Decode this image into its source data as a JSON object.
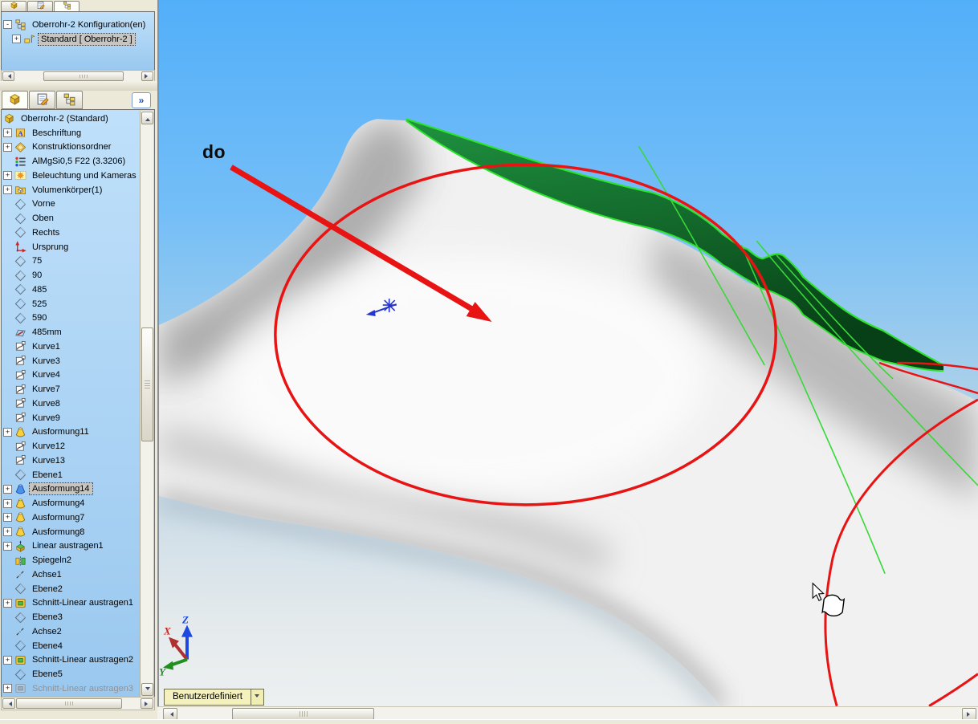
{
  "config_panel": {
    "tabs": [
      {
        "icon": "features"
      },
      {
        "icon": "properties"
      },
      {
        "icon": "configurations"
      }
    ],
    "items": [
      {
        "label": "Oberrohr-2 Konfiguration(en)",
        "icon": "configurations",
        "expand": "-",
        "level": 0
      },
      {
        "label": "Standard [ Oberrohr-2 ]",
        "icon": "config",
        "expand": "+",
        "level": 1,
        "selected": true
      }
    ]
  },
  "feature_panel": {
    "tabs": [
      {
        "icon": "features"
      },
      {
        "icon": "properties"
      },
      {
        "icon": "configurations"
      }
    ],
    "overflow_label": "»",
    "items": [
      {
        "label": "Oberrohr-2 (Standard)",
        "icon": "part",
        "root": true
      },
      {
        "label": "Beschriftung",
        "icon": "annotations",
        "expand": "+"
      },
      {
        "label": "Konstruktionsordner",
        "icon": "design-folder",
        "expand": "+"
      },
      {
        "label": "AlMgSi0,5 F22 (3.3206)",
        "icon": "material"
      },
      {
        "label": "Beleuchtung und Kameras",
        "icon": "lights",
        "expand": "+"
      },
      {
        "label": "Volumenkörper(1)",
        "icon": "solids-folder",
        "expand": "+"
      },
      {
        "label": "Vorne",
        "icon": "plane"
      },
      {
        "label": "Oben",
        "icon": "plane"
      },
      {
        "label": "Rechts",
        "icon": "plane"
      },
      {
        "label": "Ursprung",
        "icon": "origin"
      },
      {
        "label": "75",
        "icon": "plane"
      },
      {
        "label": "90",
        "icon": "plane"
      },
      {
        "label": "485",
        "icon": "plane"
      },
      {
        "label": "525",
        "icon": "plane"
      },
      {
        "label": "590",
        "icon": "plane"
      },
      {
        "label": "485mm",
        "icon": "sketch"
      },
      {
        "label": "Kurve1",
        "icon": "curve"
      },
      {
        "label": "Kurve3",
        "icon": "curve"
      },
      {
        "label": "Kurve4",
        "icon": "curve"
      },
      {
        "label": "Kurve7",
        "icon": "curve"
      },
      {
        "label": "Kurve8",
        "icon": "curve"
      },
      {
        "label": "Kurve9",
        "icon": "curve"
      },
      {
        "label": "Ausformung11",
        "icon": "loft",
        "expand": "+"
      },
      {
        "label": "Kurve12",
        "icon": "curve"
      },
      {
        "label": "Kurve13",
        "icon": "curve"
      },
      {
        "label": "Ebene1",
        "icon": "plane"
      },
      {
        "label": "Ausformung14",
        "icon": "loft-blue",
        "expand": "+",
        "selected": true
      },
      {
        "label": "Ausformung4",
        "icon": "loft",
        "expand": "+"
      },
      {
        "label": "Ausformung7",
        "icon": "loft",
        "expand": "+"
      },
      {
        "label": "Ausformung8",
        "icon": "loft",
        "expand": "+"
      },
      {
        "label": "Linear austragen1",
        "icon": "extrude",
        "expand": "+"
      },
      {
        "label": "Spiegeln2",
        "icon": "mirror"
      },
      {
        "label": "Achse1",
        "icon": "axis"
      },
      {
        "label": "Ebene2",
        "icon": "plane"
      },
      {
        "label": "Schnitt-Linear austragen1",
        "icon": "cut-extrude",
        "expand": "+"
      },
      {
        "label": "Ebene3",
        "icon": "plane"
      },
      {
        "label": "Achse2",
        "icon": "axis"
      },
      {
        "label": "Ebene4",
        "icon": "plane"
      },
      {
        "label": "Schnitt-Linear austragen2",
        "icon": "cut-extrude",
        "expand": "+"
      },
      {
        "label": "Ebene5",
        "icon": "plane"
      },
      {
        "label": "Schnitt-Linear austragen3",
        "icon": "cut-extrude",
        "expand": "+",
        "grayed": true
      }
    ]
  },
  "viewport": {
    "annotation_label": "do",
    "view_selector_value": "Benutzerdefiniert",
    "triad": {
      "x": "X",
      "y": "Y",
      "z": "Z"
    },
    "colors": {
      "annotation_red": "#e81414",
      "edge_lime": "#2ce22c",
      "sketch_blue": "#2636cc",
      "face_green_light": "#1f9240",
      "face_green_dark": "#0a4a1c"
    }
  },
  "icons": {
    "annotation_letter": "A"
  }
}
